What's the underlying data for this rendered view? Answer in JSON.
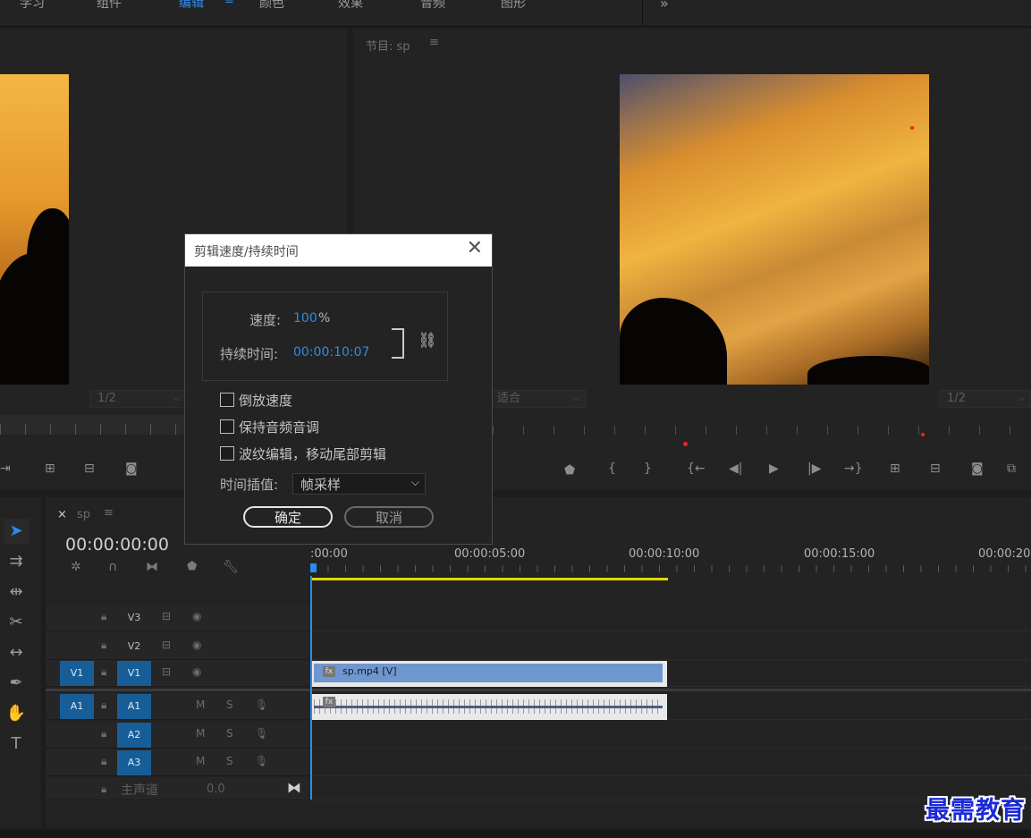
{
  "workspaces": [
    "学习",
    "组件",
    "编辑",
    "颜色",
    "效果",
    "音频",
    "图形"
  ],
  "workspace_menu_icon": "hamburger-icon",
  "overflow": "»",
  "source_monitor": {
    "zoom": "1/2",
    "controls": [
      "mark-out-icon",
      "insert-icon",
      "overwrite-icon",
      "export-frame-icon"
    ]
  },
  "program_monitor": {
    "title": "节目: sp",
    "fit": "适合",
    "zoom": "1/2",
    "controls": [
      "add-marker-icon",
      "mark-in-icon",
      "mark-out-icon",
      "go-to-in-icon",
      "step-back-icon",
      "play-icon",
      "step-forward-icon",
      "go-to-out-icon",
      "lift-icon",
      "extract-icon",
      "export-frame-icon",
      "compare-icon"
    ]
  },
  "dialog": {
    "title": "剪辑速度/持续时间",
    "speed_label": "速度:",
    "speed_value": "100",
    "speed_unit": "%",
    "duration_label": "持续时间:",
    "duration_value": "00:00:10:07",
    "reverse_label": "倒放速度",
    "maintain_pitch_label": "保持音频音调",
    "ripple_label": "波纹编辑，移动尾部剪辑",
    "interp_label": "时间插值:",
    "interp_value": "帧采样",
    "ok_label": "确定",
    "cancel_label": "取消"
  },
  "timeline": {
    "close": "×",
    "tab": "sp",
    "timecode": "00:00:00:00",
    "ruler_labels": [
      ":00:00",
      "00:00:05:00",
      "00:00:10:00",
      "00:00:15:00",
      "00:00:20:"
    ],
    "video_tracks": [
      {
        "target": "",
        "name": "V3"
      },
      {
        "target": "",
        "name": "V2"
      },
      {
        "target": "V1",
        "name": "V1"
      }
    ],
    "audio_tracks": [
      {
        "target": "A1",
        "name": "A1",
        "m": "M",
        "s": "S"
      },
      {
        "target": "",
        "name": "A2",
        "m": "M",
        "s": "S"
      },
      {
        "target": "",
        "name": "A3",
        "m": "M",
        "s": "S"
      }
    ],
    "master_label": "主声道",
    "master_value": "0.0",
    "video_clip_label": "sp.mp4 [V]",
    "fx_badge": "fx"
  },
  "tools": [
    "selection-tool",
    "track-select-tool",
    "ripple-edit-tool",
    "razor-tool",
    "slip-tool",
    "pen-tool",
    "hand-tool",
    "type-tool"
  ],
  "brand": "最需教育"
}
